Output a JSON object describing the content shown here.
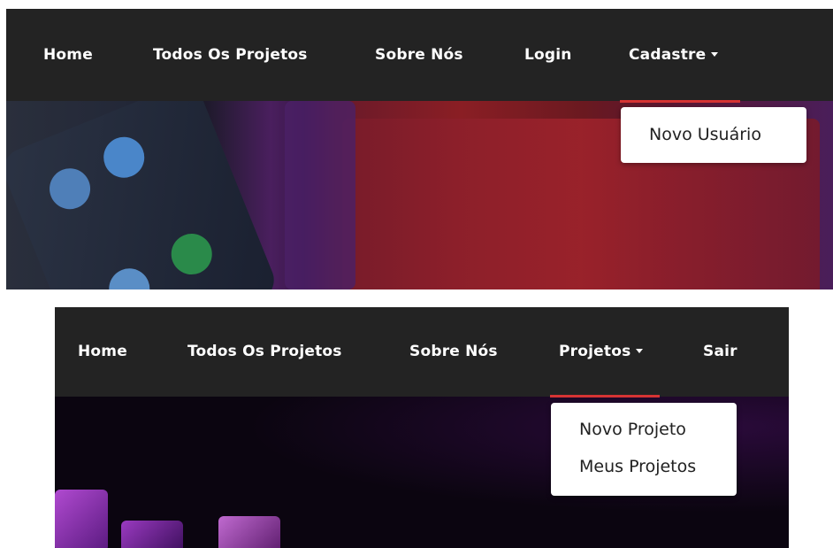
{
  "panel_visitor": {
    "nav": {
      "home": "Home",
      "all_projects": "Todos Os Projetos",
      "about": "Sobre Nós",
      "login": "Login",
      "register": "Cadastre"
    },
    "dropdown": {
      "items": [
        "Novo Usuário"
      ]
    }
  },
  "panel_user": {
    "nav": {
      "home": "Home",
      "all_projects": "Todos Os Projetos",
      "about": "Sobre Nós",
      "projects": "Projetos",
      "logout": "Sair"
    },
    "dropdown": {
      "items": [
        "Novo Projeto",
        "Meus Projetos"
      ]
    }
  },
  "colors": {
    "navbar_bg": "#232323",
    "active_underline": "#d63333",
    "nav_text": "#ffffff",
    "dropdown_bg": "#ffffff"
  },
  "icons": [
    "caret-down-icon"
  ]
}
